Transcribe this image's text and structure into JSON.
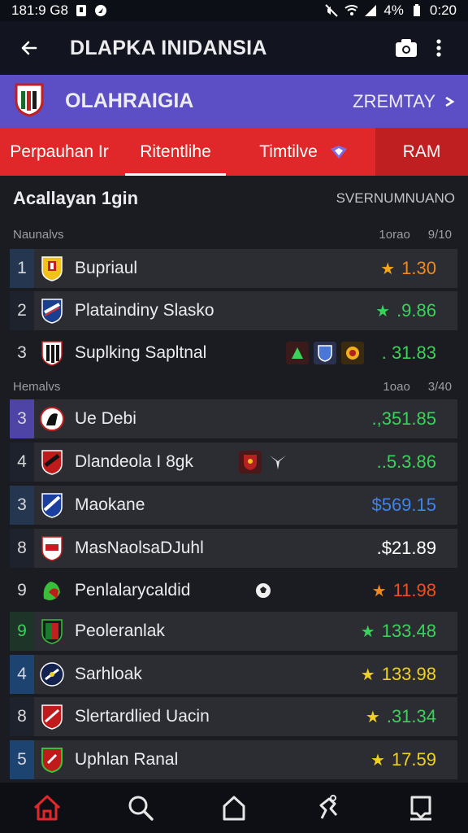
{
  "status_bar": {
    "time_left": "181:9 G8",
    "battery": "4%",
    "time_right": "0:20"
  },
  "app_bar": {
    "title": "DLAPKA INIDANSIA"
  },
  "league": {
    "name": "OLAHRAIGIA",
    "link_label": "ZREMTAY"
  },
  "tabs": [
    {
      "label": "Perpauhan Ir"
    },
    {
      "label": "Ritentlihe"
    },
    {
      "label": "Timtilve"
    },
    {
      "label": "RAM"
    }
  ],
  "section": {
    "title": "Acallayan 1gin",
    "subtitle": "SVERNUMNUANO"
  },
  "groups": [
    {
      "label": "Naunalvs",
      "col1": "1orao",
      "col2": "9/10"
    },
    {
      "label": "Hemalvs",
      "col1": "1oao",
      "col2": "3/40"
    }
  ],
  "rows": [
    {
      "rank": "1",
      "name": "Bupriaul",
      "value": "1.30",
      "icon": "star",
      "value_color": "#f08a1e",
      "icon_color": "#f3a81c"
    },
    {
      "rank": "2",
      "name": "Plataindiny Slasko",
      "value": ".9.86",
      "icon": "star",
      "value_color": "#3bd25a",
      "icon_color": "#3bd25a"
    },
    {
      "rank": "3",
      "name": "Suplking Sapltnal",
      "value": ". 31.83",
      "icon": "dots",
      "value_color": "#3bd25a",
      "icon_color": "#3bd25a"
    },
    {
      "rank": "3",
      "name": "Ue Debi",
      "value": ".,351.85",
      "icon": "",
      "value_color": "#3bd25a",
      "icon_color": ""
    },
    {
      "rank": "4",
      "name": "Dlandeola I 8gk",
      "value": "..5.3.86",
      "icon": "",
      "value_color": "#3bd25a",
      "icon_color": ""
    },
    {
      "rank": "3",
      "name": "Maokane",
      "value": "$569.15",
      "icon": "",
      "value_color": "#3d84ec",
      "icon_color": ""
    },
    {
      "rank": "8",
      "name": "MasNaolsaDJuhl",
      "value": ".$21.89",
      "icon": "",
      "value_color": "#ffffff",
      "icon_color": ""
    },
    {
      "rank": "9",
      "name": "Penlalarycaldid",
      "value": "11.98",
      "icon": "star",
      "value_color": "#f05020",
      "icon_color": "#f08a1e"
    },
    {
      "rank": "9",
      "name": "Peoleranlak",
      "value": "133.48",
      "icon": "star",
      "value_color": "#3bd25a",
      "icon_color": "#3bd25a"
    },
    {
      "rank": "4",
      "name": "Sarhloak",
      "value": "133.98",
      "icon": "star",
      "value_color": "#f0d020",
      "icon_color": "#f0d020"
    },
    {
      "rank": "8",
      "name": "Slertardlied Uacin",
      "value": ".31.34",
      "icon": "star",
      "value_color": "#3bd25a",
      "icon_color": "#f0d020"
    },
    {
      "rank": "5",
      "name": "Uphlan Ranal",
      "value": "17.59",
      "icon": "star",
      "value_color": "#f0d020",
      "icon_color": "#f0d020"
    }
  ],
  "colors": {
    "league_bar": "#5c4ec4",
    "tab_bar": "#e0282a",
    "accent_home": "#e0282a"
  }
}
